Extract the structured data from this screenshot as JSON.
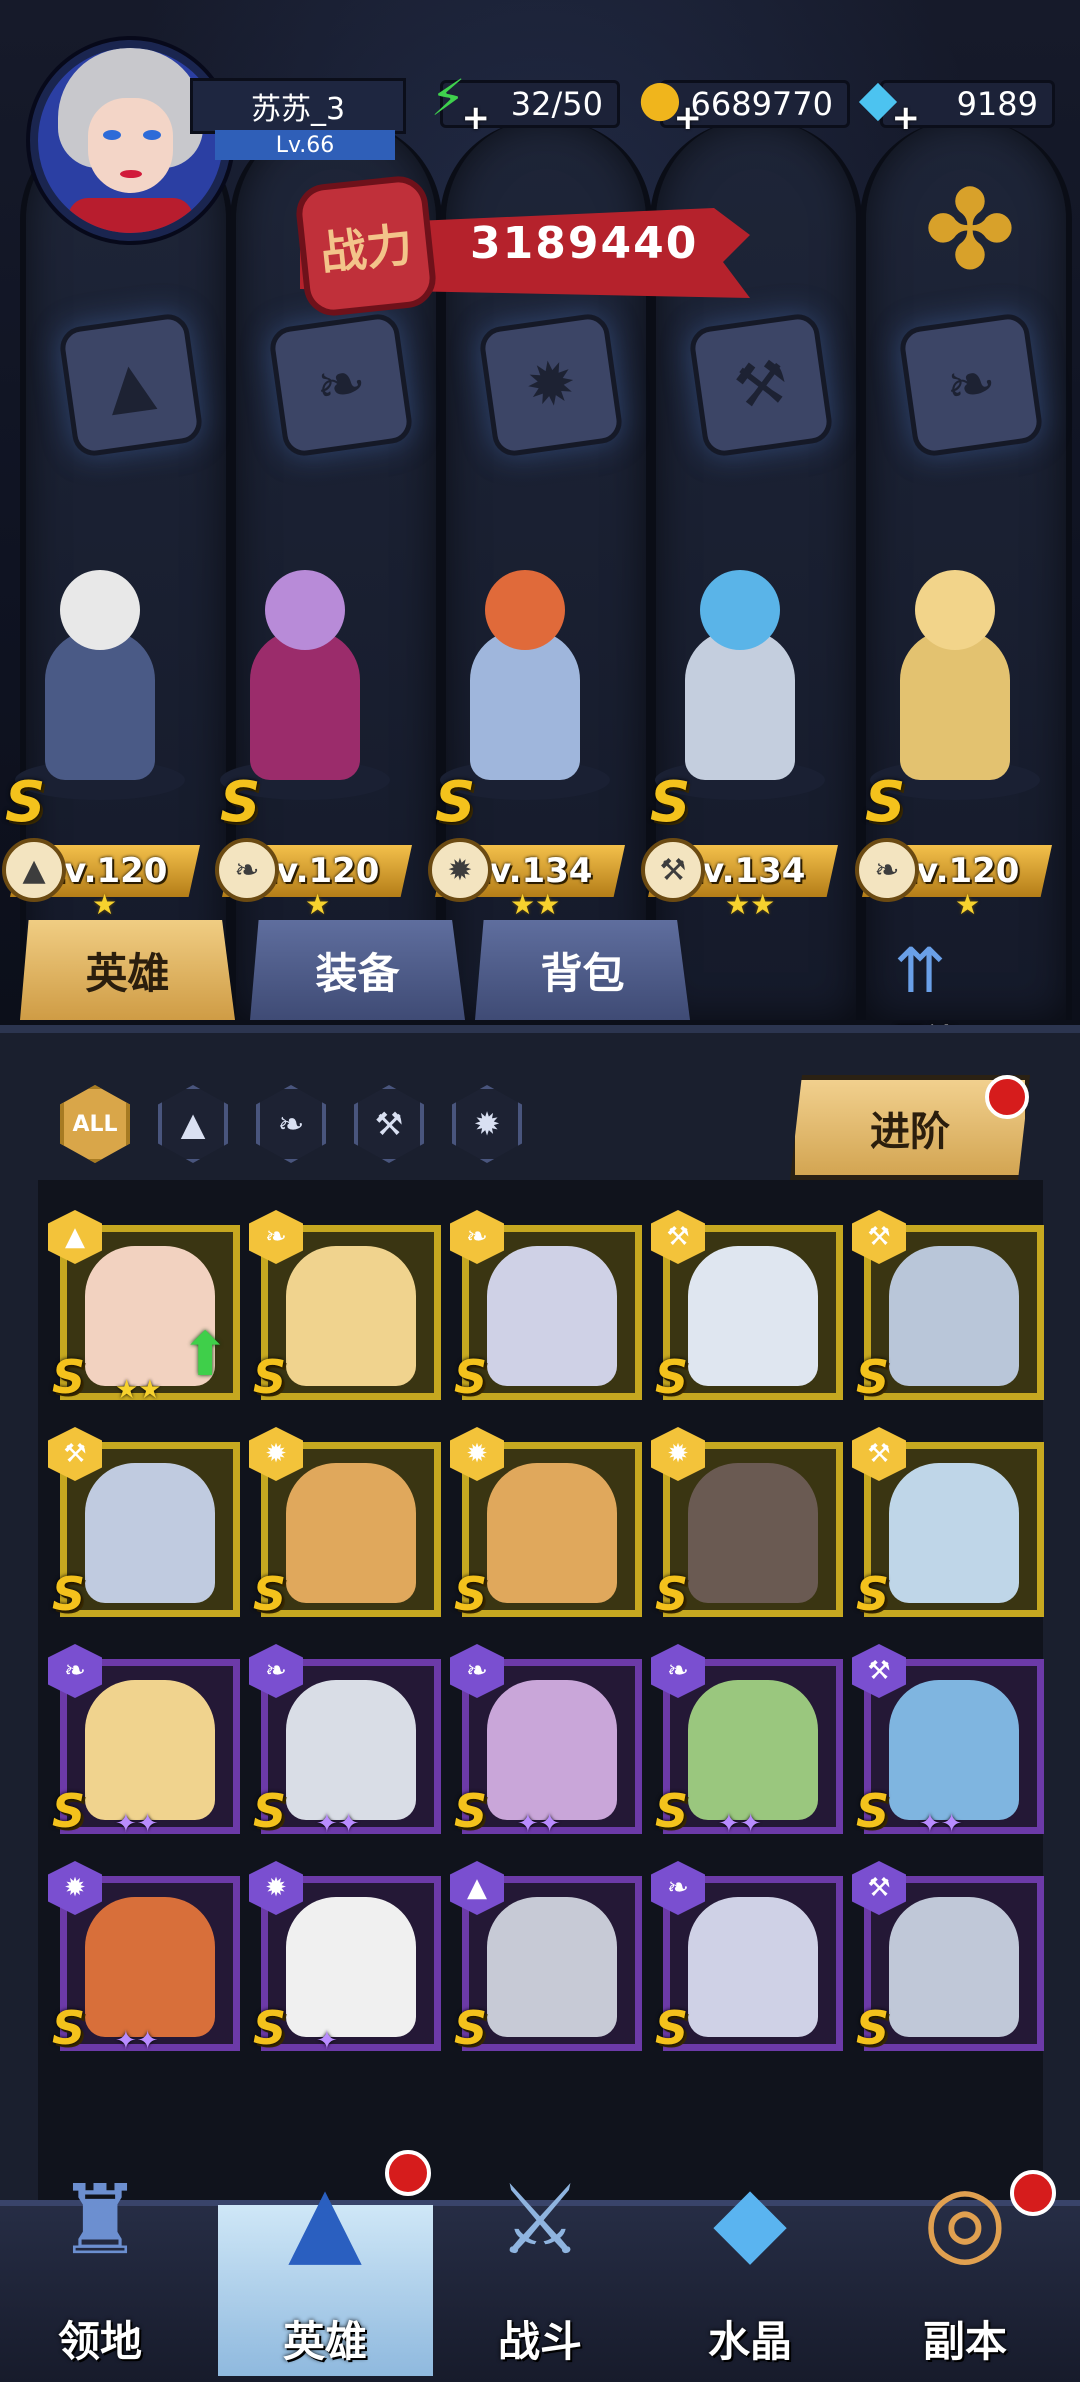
{
  "player": {
    "name": "苏苏_3",
    "level": "Lv.66"
  },
  "resources": {
    "stamina": "32/50",
    "gold": "6689770",
    "diamond": "9189"
  },
  "power": {
    "label": "战力",
    "value": "3189440"
  },
  "lineup": [
    {
      "grade": "S",
      "level": "Lv.120",
      "stars": "★",
      "class_icon": "mage-hat-icon"
    },
    {
      "grade": "S",
      "level": "Lv.120",
      "stars": "★",
      "class_icon": "wing-icon"
    },
    {
      "grade": "S",
      "level": "Lv.134",
      "stars": "★★",
      "class_icon": "beast-icon"
    },
    {
      "grade": "S",
      "level": "Lv.134",
      "stars": "★★",
      "class_icon": "wrench-icon"
    },
    {
      "grade": "S",
      "level": "Lv.120",
      "stars": "★",
      "class_icon": "wing-icon"
    }
  ],
  "tabs": {
    "heroes": "英雄",
    "equipment": "装备",
    "backpack": "背包"
  },
  "bond_label": "羁绊",
  "filters": {
    "all": "ALL"
  },
  "advance_label": "进阶",
  "hero_grid": [
    {
      "rarity": "gold",
      "grade": "S",
      "stars": "★★",
      "cls": "mage"
    },
    {
      "rarity": "gold",
      "grade": "S",
      "stars": "",
      "cls": "wing"
    },
    {
      "rarity": "gold",
      "grade": "S",
      "stars": "",
      "cls": "wing"
    },
    {
      "rarity": "gold",
      "grade": "S",
      "stars": "",
      "cls": "wrench"
    },
    {
      "rarity": "gold",
      "grade": "S",
      "stars": "",
      "cls": "wrench"
    },
    {
      "rarity": "gold",
      "grade": "S",
      "stars": "",
      "cls": "wrench"
    },
    {
      "rarity": "gold",
      "grade": "S",
      "stars": "",
      "cls": "beast"
    },
    {
      "rarity": "gold",
      "grade": "S",
      "stars": "",
      "cls": "beast"
    },
    {
      "rarity": "gold",
      "grade": "S",
      "stars": "",
      "cls": "beast"
    },
    {
      "rarity": "gold",
      "grade": "S",
      "stars": "",
      "cls": "wrench"
    },
    {
      "rarity": "purple",
      "grade": "S",
      "stars": "✦✦",
      "cls": "wing"
    },
    {
      "rarity": "purple",
      "grade": "S",
      "stars": "✦✦",
      "cls": "wing"
    },
    {
      "rarity": "purple",
      "grade": "S",
      "stars": "✦✦",
      "cls": "wing"
    },
    {
      "rarity": "purple",
      "grade": "S",
      "stars": "✦✦",
      "cls": "wing"
    },
    {
      "rarity": "purple",
      "grade": "S",
      "stars": "✦✦",
      "cls": "wrench"
    },
    {
      "rarity": "purple",
      "grade": "S",
      "stars": "✦✦",
      "cls": "beast"
    },
    {
      "rarity": "purple",
      "grade": "S",
      "stars": "✦",
      "cls": "beast"
    },
    {
      "rarity": "purple",
      "grade": "S",
      "stars": "",
      "cls": "mage"
    },
    {
      "rarity": "purple",
      "grade": "S",
      "stars": "",
      "cls": "wing"
    },
    {
      "rarity": "purple",
      "grade": "S",
      "stars": "",
      "cls": "wrench"
    }
  ],
  "nav": {
    "territory": "领地",
    "heroes": "英雄",
    "battle": "战斗",
    "crystal": "水晶",
    "dungeon": "副本"
  }
}
